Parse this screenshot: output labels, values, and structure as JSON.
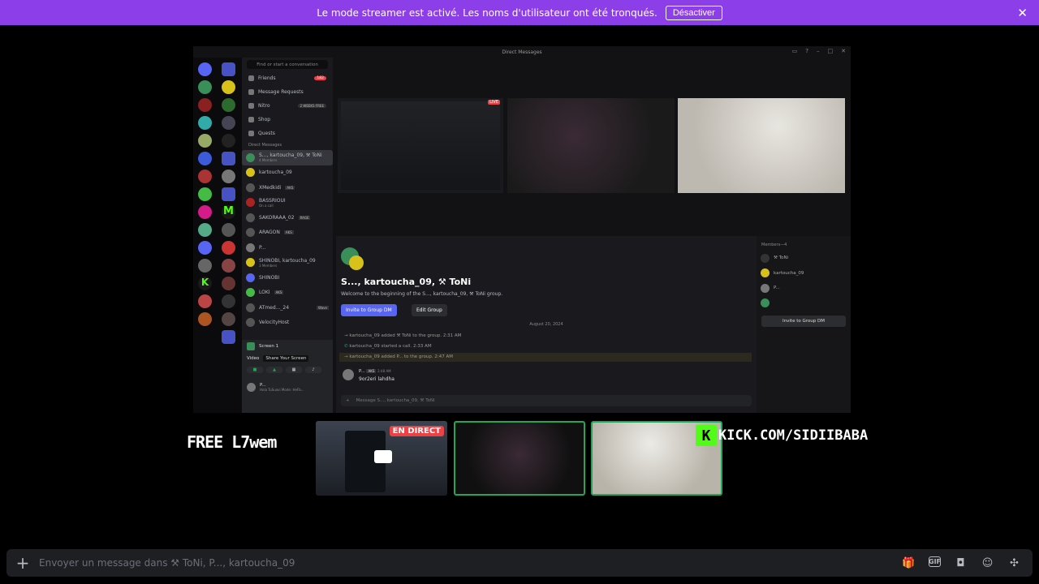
{
  "banner": {
    "message": "Le mode streamer est activé. Les noms d'utilisateur ont été tronqués.",
    "button": "Désactiver"
  },
  "share": {
    "window_title": "Direct Messages",
    "search": "Find or start a conversation",
    "nav": [
      {
        "label": "Friends",
        "badge": "182"
      },
      {
        "label": "Message Requests"
      },
      {
        "label": "Nitro",
        "tag": "2 WEEKS FREE"
      },
      {
        "label": "Shop"
      },
      {
        "label": "Quests"
      }
    ],
    "dm_header": "Direct Messages",
    "dms": [
      {
        "name": "S..., kartoucha_09, ⚒ ToNi",
        "sub": "4 Members"
      },
      {
        "name": "kartoucha_09"
      },
      {
        "name": "XMedkidi",
        "tag": "AKS"
      },
      {
        "name": "BASSRIOUI",
        "sub": "On a call"
      },
      {
        "name": "SAKORAAA_02",
        "tag": "RAGE"
      },
      {
        "name": "ARAGON",
        "tag": "AKS"
      },
      {
        "name": "P..."
      },
      {
        "name": "SHINOBI, kartoucha_09",
        "sub": "3 Members"
      },
      {
        "name": "SHINOBI"
      },
      {
        "name": "LOKI",
        "tag": "AKS"
      },
      {
        "name": "ATmed..._24",
        "tag": "Wave"
      },
      {
        "name": "VelocityHost"
      }
    ],
    "voice": {
      "title": "Screen 1",
      "status": "Video",
      "share_label": "Share Your Screen"
    },
    "user": {
      "name": "P...",
      "status": "Hola TuSuavi Mode: HeFb..."
    },
    "chat": {
      "title": "S..., kartoucha_09, ⚒ ToNi",
      "welcome": "Welcome to the beginning of the S..., kartoucha_09, ⚒ ToNi group.",
      "invite": "Invite to Group DM",
      "edit": "Edit Group",
      "date": "August 20, 2024",
      "events": [
        "kartoucha_09 added ⚒ ToNi to the group. 2:31 AM",
        "kartoucha_09 started a call. 2:33 AM",
        "kartoucha_09 added P... to the group. 2:47 AM"
      ],
      "msg_author": "P...",
      "msg_tag": "AKS",
      "msg_time": "2:48 AM",
      "msg_text": "9or2eri lahdha",
      "input": "Message S..., kartoucha_09, ⚒ ToNi"
    },
    "members": {
      "header": "Members—4",
      "list": [
        "⚒ ToNi",
        "kartoucha_09",
        "P...",
        ""
      ],
      "invite": "Invite to Group DM"
    }
  },
  "overlay": {
    "free_text": "FREE L7wem",
    "live": "EN DIRECT",
    "kick": "KICK.COM/SIDIIBABA"
  },
  "composer": {
    "placeholder": "Envoyer un message dans ⚒ ToNi, P..., kartoucha_09"
  },
  "colors": {
    "banner": "#8c3ee8",
    "accent": "#5865f2",
    "kick": "#53fc18",
    "live": "#ed4245"
  }
}
